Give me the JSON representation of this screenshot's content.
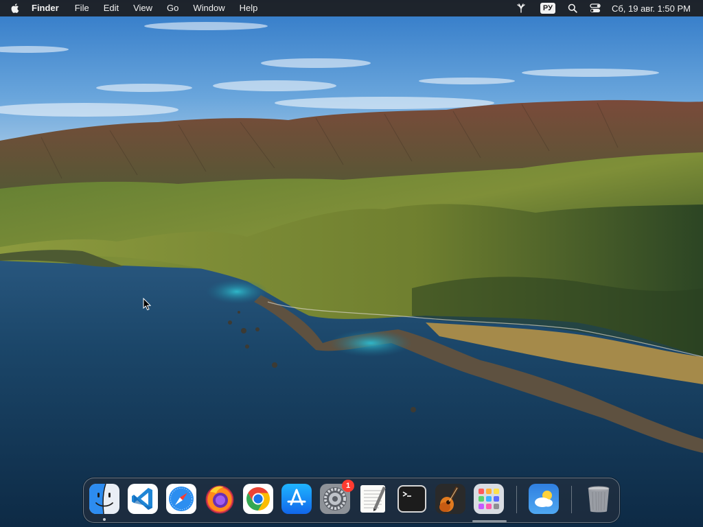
{
  "menubar": {
    "app_name": "Finder",
    "menus": [
      "File",
      "Edit",
      "View",
      "Go",
      "Window",
      "Help"
    ],
    "input_source": "РУ",
    "clock": "Сб, 19 авг.  1:50 PM"
  },
  "dock": {
    "apps": [
      {
        "name": "Finder",
        "icon": "finder-icon",
        "running": true
      },
      {
        "name": "Visual Studio Code",
        "icon": "vscode-icon",
        "running": false
      },
      {
        "name": "Safari",
        "icon": "safari-icon",
        "running": false
      },
      {
        "name": "Firefox",
        "icon": "firefox-icon",
        "running": false
      },
      {
        "name": "Google Chrome",
        "icon": "chrome-icon",
        "running": false
      },
      {
        "name": "App Store",
        "icon": "app-store-icon",
        "running": false
      },
      {
        "name": "System Settings",
        "icon": "system-settings-icon",
        "running": false,
        "badge": "1"
      },
      {
        "name": "TextEdit",
        "icon": "textedit-icon",
        "running": false
      },
      {
        "name": "Terminal",
        "icon": "terminal-icon",
        "running": false
      },
      {
        "name": "GarageBand",
        "icon": "garageband-icon",
        "running": false
      },
      {
        "name": "Launchpad",
        "icon": "launchpad-icon",
        "running": false
      },
      {
        "name": "Weather",
        "icon": "weather-icon",
        "running": false
      },
      {
        "name": "Trash",
        "icon": "trash-icon",
        "running": false
      }
    ]
  },
  "colors": {
    "menubar_bg": "#1c1c1e",
    "badge": "#ff3b30",
    "sky": "#4a8fd0",
    "ocean": "#123a5c"
  }
}
